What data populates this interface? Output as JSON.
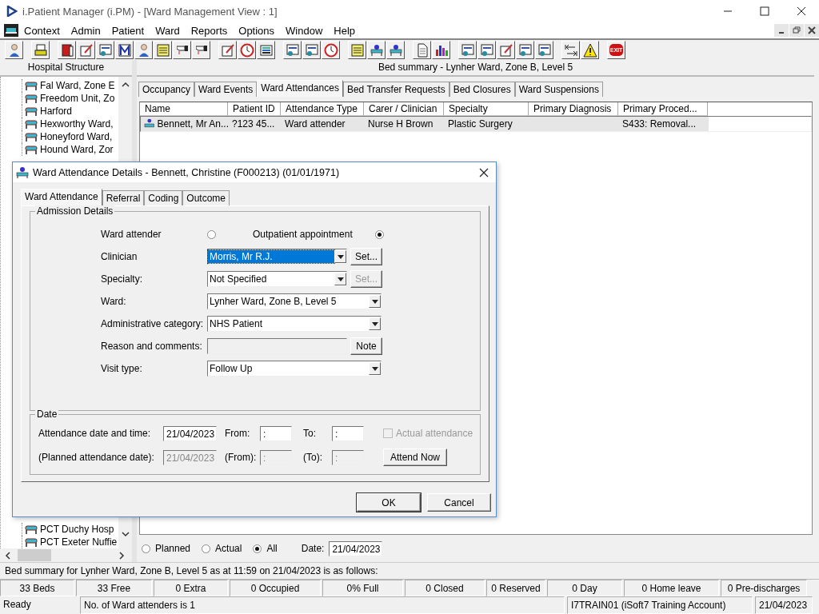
{
  "window": {
    "title": "i.Patient Manager (i.PM) - [Ward Management View : 1]"
  },
  "menu": [
    "Context",
    "Admin",
    "Patient",
    "Ward",
    "Reports",
    "Options",
    "Window",
    "Help"
  ],
  "toolbar": {
    "exit_label": "EXIT"
  },
  "hospital_structure": {
    "title": "Hospital Structure",
    "items_top": [
      "Fal Ward, Zone E",
      "Freedom Unit, Zo",
      "Harford",
      "Hexworthy Ward,",
      "Honeyford Ward,",
      "Hound Ward, Zor"
    ],
    "items_bottom": [
      "PCT Duchy Hosp",
      "PCT Exeter Nuffie"
    ]
  },
  "bed_summary_title": "Bed summary - Lynher Ward, Zone B, Level 5",
  "tabs": [
    {
      "label": "Occupancy",
      "selected": false
    },
    {
      "label": "Ward Events",
      "selected": false
    },
    {
      "label": "Ward Attendances",
      "selected": true
    },
    {
      "label": "Bed Transfer Requests",
      "selected": false
    },
    {
      "label": "Bed Closures",
      "selected": false
    },
    {
      "label": "Ward Suspensions",
      "selected": false
    }
  ],
  "table": {
    "columns": [
      "Name",
      "Patient ID",
      "Attendance Type",
      "Carer / Clinician",
      "Specialty",
      "Primary Diagnosis",
      "Primary Proced..."
    ],
    "rows": [
      {
        "selected": true,
        "cells": [
          "Bennett, Mr An...",
          "?123 45...",
          "Ward attender",
          "Nurse H Brown",
          "Plastic Surgery",
          "",
          "S433: Removal..."
        ]
      }
    ]
  },
  "filter": {
    "options": [
      {
        "label": "Planned",
        "selected": false
      },
      {
        "label": "Actual",
        "selected": false
      },
      {
        "label": "All",
        "selected": true
      }
    ],
    "date_label": "Date:",
    "date": "21/04/2023"
  },
  "summary_line": "Bed summary for Lynher Ward, Zone B, Level 5 as at 11:59 on 21/04/2023 is as follows:",
  "stats": [
    "33 Beds",
    "33 Free",
    "0 Extra",
    "0 Occupied",
    "0% Full",
    "0 Closed",
    "0 Reserved",
    "0 Day",
    "0 Home leave",
    "0 Pre-discharges"
  ],
  "status_bar": [
    "Ready",
    "No. of Ward attenders is 1",
    "I7TRAIN01 (iSoft7 Training Account)",
    "21/04/2023"
  ],
  "dialog": {
    "title": "Ward Attendance Details - Bennett, Christine (F000213) (01/01/1971)",
    "tabs": [
      {
        "label": "Ward Attendance",
        "selected": true
      },
      {
        "label": "Referral",
        "selected": false
      },
      {
        "label": "Coding",
        "selected": false
      },
      {
        "label": "Outcome",
        "selected": false
      }
    ],
    "admission": {
      "title": "Admission Details",
      "attendance_types": [
        {
          "label": "Ward attender",
          "selected": false
        },
        {
          "label": "Outpatient appointment",
          "selected": true
        }
      ],
      "fields": [
        {
          "label": "Clinician",
          "kind": "select",
          "value": "Morris, Mr R.J.",
          "focused": true,
          "button": {
            "label": "Set...",
            "disabled": false
          }
        },
        {
          "label": "Specialty:",
          "kind": "select",
          "value": "Not Specified",
          "focused": false,
          "button": {
            "label": "Set...",
            "disabled": true
          }
        },
        {
          "label": "Ward:",
          "kind": "select",
          "value": "Lynher Ward, Zone B, Level 5",
          "focused": false
        },
        {
          "label": "Administrative  category:",
          "kind": "select",
          "value": "NHS Patient",
          "focused": false
        },
        {
          "label": "Reason and comments:",
          "kind": "text",
          "button": {
            "label": "Note",
            "disabled": false
          }
        },
        {
          "label": "Visit type:",
          "kind": "select",
          "value": "Follow Up",
          "focused": false
        }
      ]
    },
    "date": {
      "title": "Date",
      "rows": [
        {
          "label": "Attendance  date and time:",
          "date": "21/04/2023",
          "from_label": "From:",
          "from": ":",
          "to_label": "To:",
          "to": ":",
          "disabled": false
        },
        {
          "label": "(Planned attendance date):",
          "date": "21/04/2023",
          "from_label": "(From):",
          "from": ":",
          "to_label": "(To):",
          "to": ":",
          "disabled": true
        }
      ],
      "actual_attendance": {
        "label": "Actual attendance",
        "checked": false,
        "disabled": true
      },
      "attend_now": "Attend Now"
    },
    "buttons": [
      "OK",
      "Cancel"
    ]
  }
}
